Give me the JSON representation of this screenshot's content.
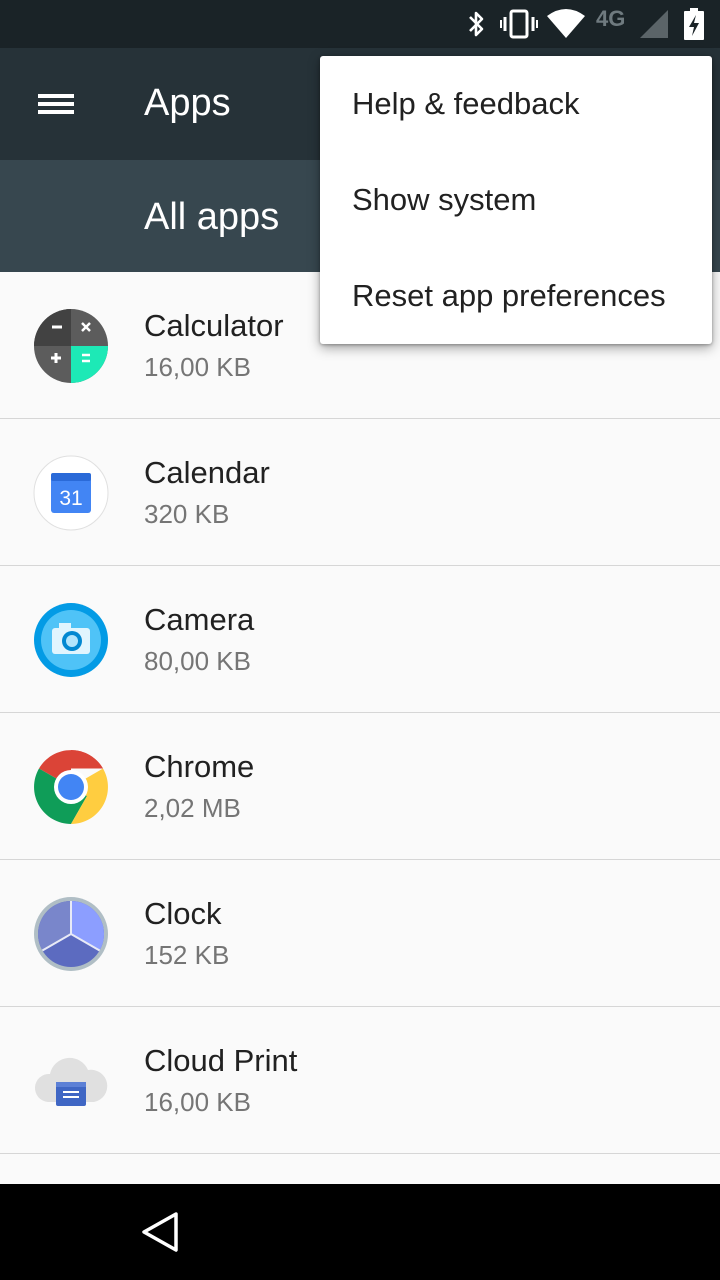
{
  "status_bar": {
    "network": "4G",
    "icons": [
      "bluetooth-icon",
      "vibrate-icon",
      "wifi-icon",
      "cell-signal-icon",
      "battery-charging-icon"
    ]
  },
  "toolbar": {
    "title": "Apps",
    "menu_icon": "hamburger-icon"
  },
  "tabs": {
    "current": "All apps"
  },
  "apps": [
    {
      "name": "Calculator",
      "size": "16,00 KB",
      "icon": "calculator-icon"
    },
    {
      "name": "Calendar",
      "size": "320 KB",
      "icon": "calendar-icon",
      "icon_text": "31"
    },
    {
      "name": "Camera",
      "size": "80,00 KB",
      "icon": "camera-icon"
    },
    {
      "name": "Chrome",
      "size": "2,02 MB",
      "icon": "chrome-icon"
    },
    {
      "name": "Clock",
      "size": "152 KB",
      "icon": "clock-icon"
    },
    {
      "name": "Cloud Print",
      "size": "16,00 KB",
      "icon": "cloud-print-icon"
    }
  ],
  "overflow_menu": {
    "items": [
      "Help & feedback",
      "Show system",
      "Reset app preferences"
    ]
  },
  "colors": {
    "status_bar": "#1a2327",
    "toolbar": "#263238",
    "tab_bar": "#37474f",
    "list_bg": "#fafafa"
  }
}
